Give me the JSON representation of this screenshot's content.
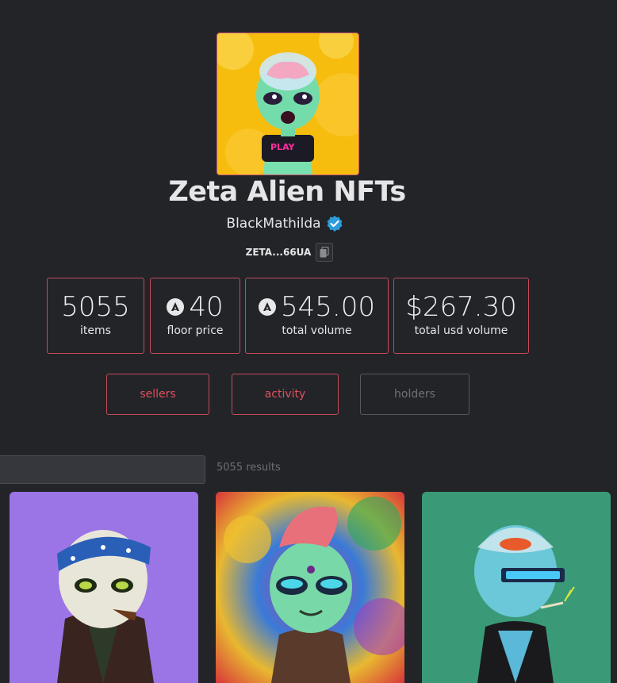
{
  "collection": {
    "name": "Zeta Alien NFTs",
    "creator": "BlackMathilda",
    "address": "ZETA...66UA",
    "avatar_bg": "#f5b700"
  },
  "stats": [
    {
      "value": "5055",
      "label": "items",
      "coin": false
    },
    {
      "value": "40",
      "label": "floor price",
      "coin": true
    },
    {
      "value": "545.00",
      "label": "total volume",
      "coin": true
    },
    {
      "value": "$267.30",
      "label": "total usd volume",
      "coin": false
    }
  ],
  "tabs": [
    {
      "label": "sellers",
      "active": true
    },
    {
      "label": "activity",
      "active": true
    },
    {
      "label": "holders",
      "active": false
    }
  ],
  "search": {
    "placeholder": ""
  },
  "results_text": "5055 results",
  "grid": {
    "cards": [
      {
        "bg": "#9b74e6",
        "icon": "bandana-alien-image"
      },
      {
        "bg": "#d94a5a",
        "icon": "mohawk-alien-image"
      },
      {
        "bg": "#3a9a78",
        "icon": "visor-alien-image"
      }
    ]
  },
  "colors": {
    "accent": "#c54b59",
    "accent_text": "#e0505e",
    "background": "#222428",
    "verified": "#2d9cdb"
  }
}
